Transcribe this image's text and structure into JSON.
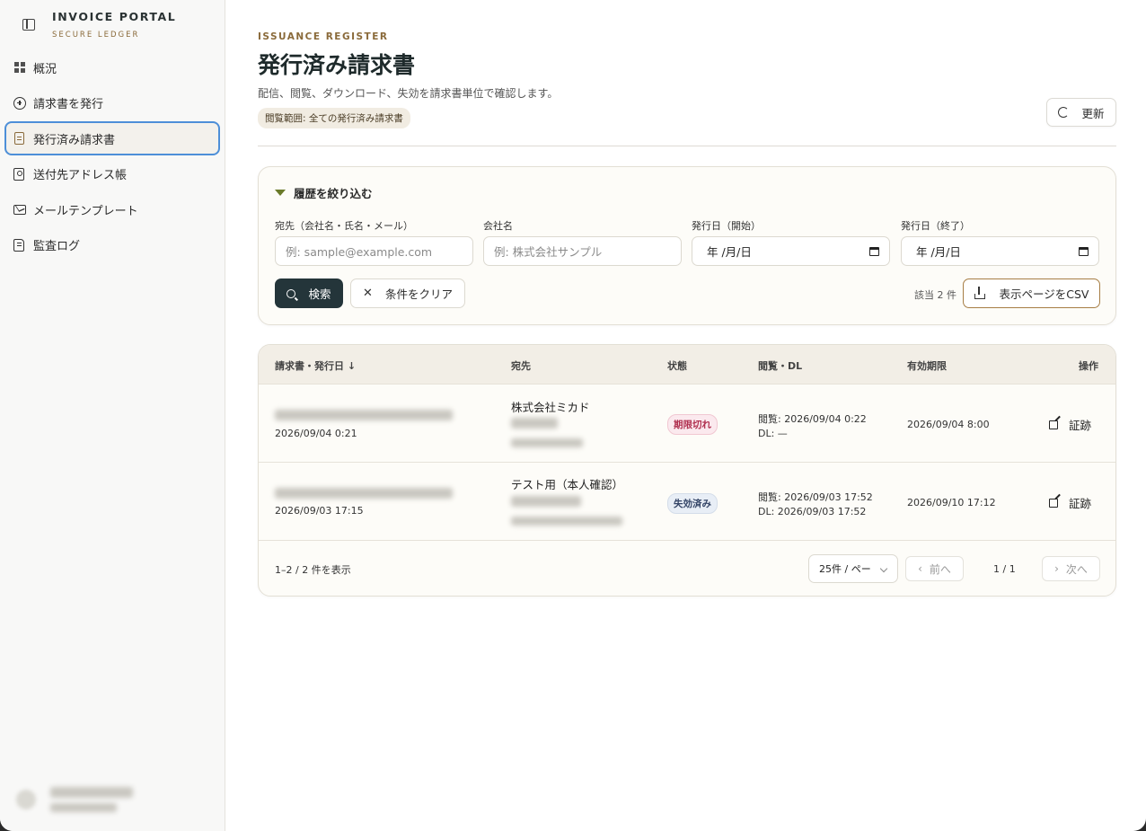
{
  "sidebar": {
    "brand_title": "INVOICE PORTAL",
    "brand_sub": "SECURE LEDGER",
    "items": [
      {
        "label": "概況"
      },
      {
        "label": "請求書を発行"
      },
      {
        "label": "発行済み請求書"
      },
      {
        "label": "送付先アドレス帳"
      },
      {
        "label": "メールテンプレート"
      },
      {
        "label": "監査ログ"
      }
    ]
  },
  "header": {
    "eyebrow": "ISSUANCE REGISTER",
    "title": "発行済み請求書",
    "description": "配信、閲覧、ダウンロード、失効を請求書単位で確認します。",
    "scope_badge": "閲覧範囲: 全ての発行済み請求書",
    "refresh_label": "更新"
  },
  "filter": {
    "heading": "履歴を絞り込む",
    "fields": [
      {
        "label": "宛先（会社名・氏名・メール）",
        "placeholder": "例: sample@example.com"
      },
      {
        "label": "会社名",
        "placeholder": "例: 株式会社サンプル"
      },
      {
        "label": "発行日（開始）",
        "value": "年 /月/日"
      },
      {
        "label": "発行日（終了）",
        "value": "年 /月/日"
      }
    ],
    "search_label": "検索",
    "clear_label": "条件をクリア",
    "count_text": "該当 2 件",
    "csv_label": "表示ページをCSV"
  },
  "table": {
    "columns": [
      "請求書・発行日",
      "宛先",
      "状態",
      "閲覧・DL",
      "有効期限",
      "操作"
    ],
    "sort_indicator": "↓",
    "rows": [
      {
        "issued": "2026/09/04 0:21",
        "recipient": "株式会社ミカド",
        "status": "期限切れ",
        "status_type": "expired",
        "viewed": "閲覧: 2026/09/04 0:22",
        "downloaded": "DL: —",
        "expires": "2026/09/04 8:00",
        "action": "証跡"
      },
      {
        "issued": "2026/09/03 17:15",
        "recipient": "テスト用（本人確認）",
        "status": "失効済み",
        "status_type": "revoked",
        "viewed": "閲覧: 2026/09/03 17:52",
        "downloaded": "DL: 2026/09/03 17:52",
        "expires": "2026/09/10 17:12",
        "action": "証跡"
      }
    ],
    "footer": {
      "summary": "1–2 / 2 件を表示",
      "per_page": "25件 / ペー",
      "prev": "前へ",
      "page": "1 / 1",
      "next": "次へ"
    }
  },
  "colors": {
    "accent": "#8a6a3a",
    "primary_button": "#24353a",
    "active_border": "#4d8fd8"
  }
}
